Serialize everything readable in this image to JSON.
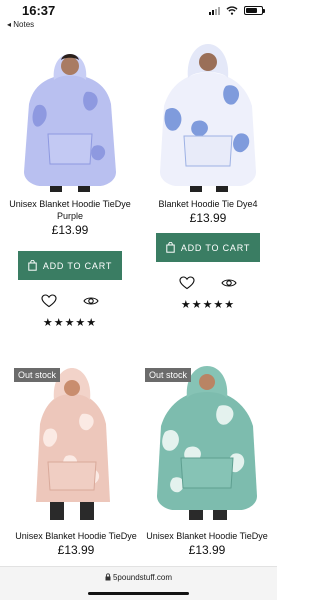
{
  "status_bar": {
    "time": "16:37",
    "back_label": "◂ Notes"
  },
  "products": [
    {
      "title": "Unisex Blanket Hoodie TieDye Purple",
      "price": "£13.99",
      "cart_label": "ADD TO CART",
      "rating": "★★★★★"
    },
    {
      "title": "Blanket Hoodie Tie Dye4",
      "price": "£13.99",
      "cart_label": "ADD TO CART",
      "rating": "★★★★★"
    },
    {
      "title": "Unisex Blanket Hoodie TieDye",
      "price": "£13.99",
      "badge": "Out stock"
    },
    {
      "title": "Unisex Blanket Hoodie TieDye",
      "price": "£13.99",
      "badge": "Out stock"
    }
  ],
  "browser": {
    "url": "5poundstuff.com"
  },
  "colors": {
    "cart_button": "#3a7d63",
    "badge": "#6b6b6b",
    "hoodie_purple": "#9aa4e6",
    "hoodie_blue": "#7f9bdc",
    "hoodie_pink": "#e9b7a8",
    "hoodie_teal": "#75b6a7"
  },
  "icons": [
    "wifi-icon",
    "battery-icon",
    "shopping-bag-icon",
    "heart-icon",
    "eye-icon",
    "lock-icon"
  ]
}
